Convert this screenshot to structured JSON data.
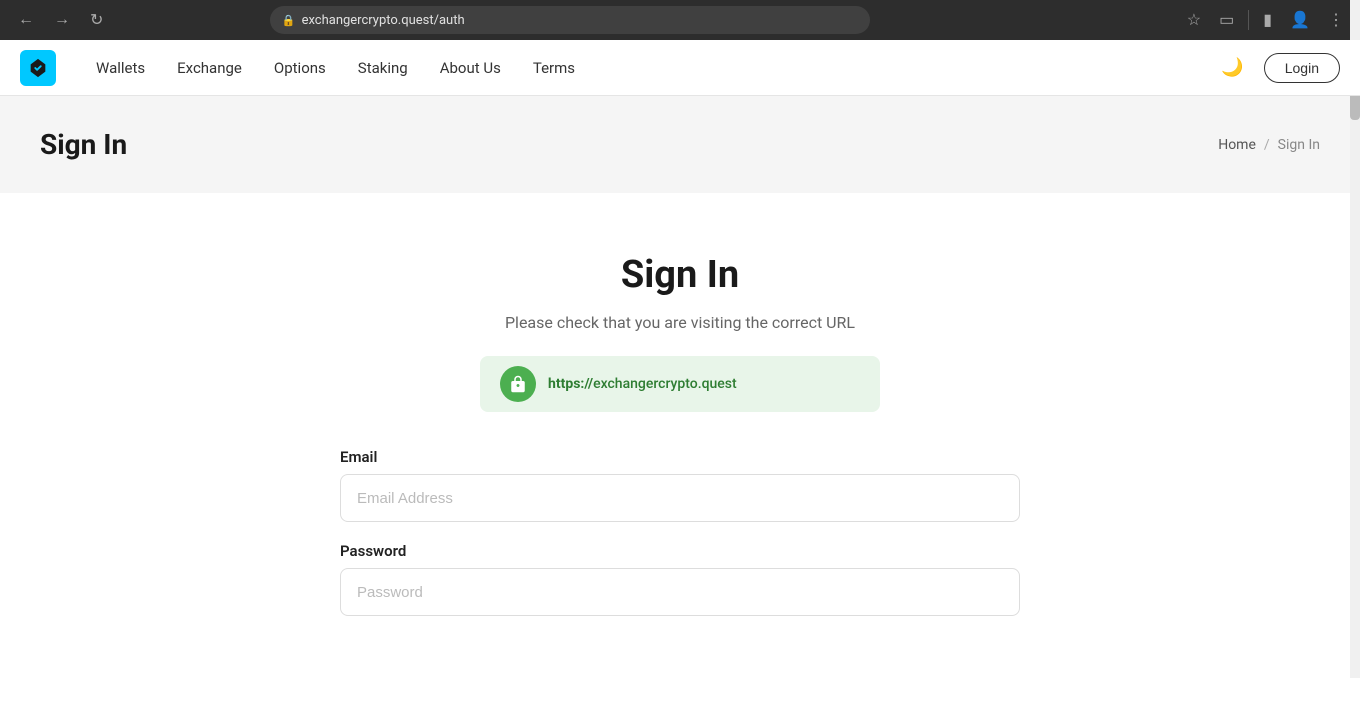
{
  "browser": {
    "back_disabled": false,
    "forward_disabled": false,
    "url": "exchangercrypto.quest/auth",
    "lock_icon": "🔒",
    "star_icon": "☆",
    "extensions_icon": "⬜",
    "profile_icon": "👤",
    "menu_icon": "⋮",
    "sidebar_icon": "▣"
  },
  "navbar": {
    "logo_alt": "ExchangerCrypto Logo",
    "links": [
      {
        "label": "Wallets",
        "href": "#"
      },
      {
        "label": "Exchange",
        "href": "#"
      },
      {
        "label": "Options",
        "href": "#"
      },
      {
        "label": "Staking",
        "href": "#"
      },
      {
        "label": "About Us",
        "href": "#"
      },
      {
        "label": "Terms",
        "href": "#"
      }
    ],
    "dark_mode_icon": "🌙",
    "login_label": "Login"
  },
  "page_header": {
    "title": "Sign In",
    "breadcrumb": {
      "home": "Home",
      "separator": "/",
      "current": "Sign In"
    }
  },
  "main": {
    "title": "Sign In",
    "subtitle": "Please check that you are visiting the correct URL",
    "url_verification": {
      "lock_icon": "🔒",
      "url_prefix": "https://",
      "url_domain": "exchangercrypto.quest"
    },
    "form": {
      "email_label": "Email",
      "email_placeholder": "Email Address",
      "password_label": "Password",
      "password_placeholder": "Password"
    }
  }
}
